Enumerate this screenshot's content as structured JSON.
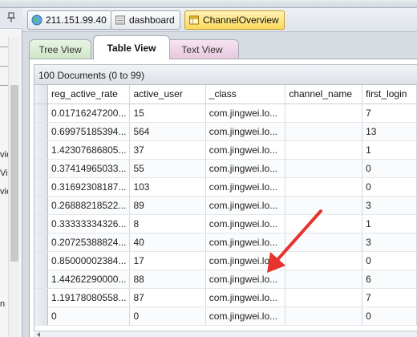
{
  "address_bar": {
    "server": "211.151.99.40",
    "database": "dashboard",
    "collection": "ChannelOverview"
  },
  "tabs": [
    "Tree View",
    "Table View",
    "Text View"
  ],
  "active_tab": "Table View",
  "doc_count": "100 Documents (0 to 99)",
  "sidebar_fragments": [
    "vie",
    "Vi",
    "vie",
    "n"
  ],
  "columns": [
    "reg_active_rate",
    "active_user",
    "_class",
    "channel_name",
    "first_login"
  ],
  "rows": [
    [
      "0.01716247200...",
      "15",
      "com.jingwei.lo...",
      "",
      "7"
    ],
    [
      "0.69975185394...",
      "564",
      "com.jingwei.lo...",
      "",
      "13"
    ],
    [
      "1.42307686805...",
      "37",
      "com.jingwei.lo...",
      "",
      "1"
    ],
    [
      "0.37414965033...",
      "55",
      "com.jingwei.lo...",
      "",
      "0"
    ],
    [
      "0.31692308187...",
      "103",
      "com.jingwei.lo...",
      "",
      "0"
    ],
    [
      "0.26888218522...",
      "89",
      "com.jingwei.lo...",
      "",
      "3"
    ],
    [
      "0.33333334326...",
      "8",
      "com.jingwei.lo...",
      "",
      "1"
    ],
    [
      "0.20725388824...",
      "40",
      "com.jingwei.lo...",
      "",
      "3"
    ],
    [
      "0.85000002384...",
      "17",
      "com.jingwei.lo...",
      "",
      "0"
    ],
    [
      "1.44262290000...",
      "88",
      "com.jingwei.lo...",
      "",
      "6"
    ],
    [
      "1.19178080558...",
      "87",
      "com.jingwei.lo...",
      "",
      "7"
    ],
    [
      "0",
      "0",
      "com.jingwei.lo...",
      "",
      "0"
    ]
  ],
  "colors": {
    "active_chip": "#fbd95a",
    "tree_tab": "#cfe6c6",
    "text_tab": "#e8c8de",
    "annotation_arrow": "#e8322d"
  },
  "icons": {
    "server": "globe-icon",
    "database": "database-icon",
    "collection": "collection-icon",
    "sidebar": "pin-icon"
  }
}
